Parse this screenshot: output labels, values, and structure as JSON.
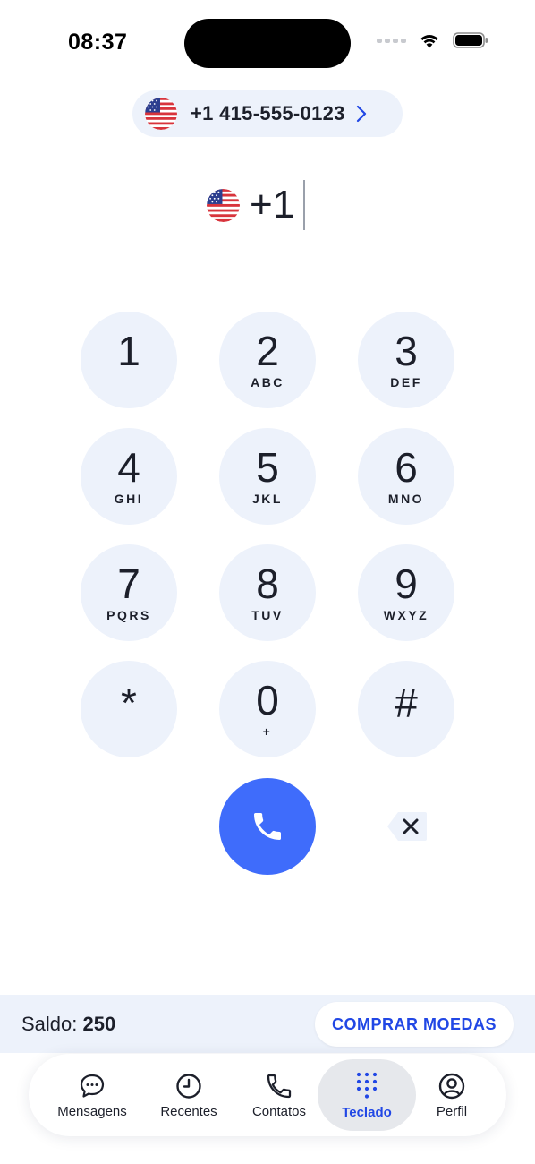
{
  "status_bar": {
    "time": "08:37",
    "icons": [
      "signal-dots-icon",
      "wifi-icon",
      "battery-icon"
    ]
  },
  "selected_number": {
    "flag": "us-flag-icon",
    "number": "+1 415-555-0123",
    "chevron": "chevron-right-icon"
  },
  "entry": {
    "flag": "us-flag-icon",
    "value": "+1"
  },
  "keypad": {
    "keys": [
      {
        "digit": "1",
        "letters": ""
      },
      {
        "digit": "2",
        "letters": "ABC"
      },
      {
        "digit": "3",
        "letters": "DEF"
      },
      {
        "digit": "4",
        "letters": "GHI"
      },
      {
        "digit": "5",
        "letters": "JKL"
      },
      {
        "digit": "6",
        "letters": "MNO"
      },
      {
        "digit": "7",
        "letters": "PQRS"
      },
      {
        "digit": "8",
        "letters": "TUV"
      },
      {
        "digit": "9",
        "letters": "WXYZ"
      },
      {
        "digit": "*",
        "letters": ""
      },
      {
        "digit": "0",
        "letters": "+"
      },
      {
        "digit": "#",
        "letters": ""
      }
    ],
    "call_icon": "phone-icon",
    "backspace_icon": "backspace-icon"
  },
  "balance": {
    "label": "Saldo:",
    "value": "250",
    "buy_label": "COMPRAR MOEDAS"
  },
  "tabs": [
    {
      "label": "Mensagens",
      "icon": "chat-bubble-icon",
      "active": false
    },
    {
      "label": "Recentes",
      "icon": "clock-icon",
      "active": false
    },
    {
      "label": "Contatos",
      "icon": "phone-outline-icon",
      "active": false
    },
    {
      "label": "Teclado",
      "icon": "dialpad-icon",
      "active": true
    },
    {
      "label": "Perfil",
      "icon": "profile-icon",
      "active": false
    }
  ],
  "colors": {
    "accent": "#3f6cfb",
    "accent_text": "#2147e5",
    "key_background": "#edf2fb",
    "text": "#1c1f2a"
  }
}
